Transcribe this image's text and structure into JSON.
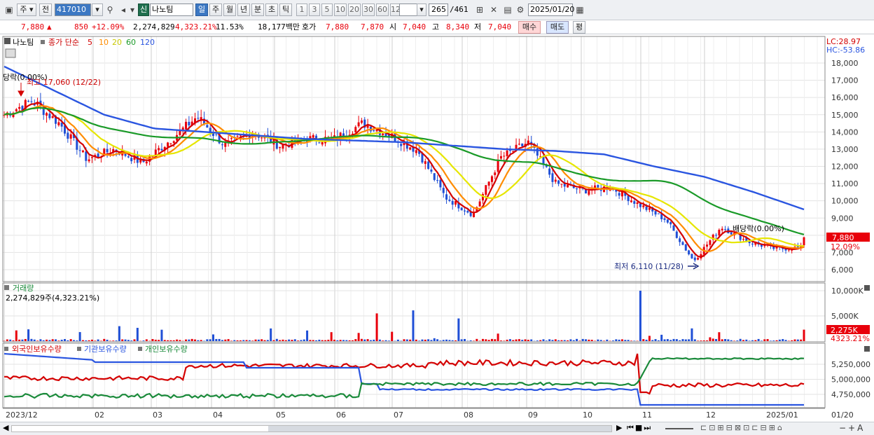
{
  "toolbar": {
    "type_label": "주",
    "prev_label": "전",
    "code_value": "417010",
    "market_badge": "신",
    "stock_name": "나노팀",
    "periods": [
      "일",
      "주",
      "월",
      "년",
      "분",
      "초",
      "틱"
    ],
    "active_period": "일",
    "intervals": [
      "1",
      "3",
      "5",
      "10",
      "20",
      "30",
      "60",
      "120"
    ],
    "count_value": "265",
    "count_total": "/461",
    "date_value": "2025/01/20"
  },
  "quote": {
    "price": "7,880",
    "change_arrow": "▲",
    "change": "850",
    "change_pct": "+12.09%",
    "volume": "2,274,829",
    "volume_ratio": "4,323.21%",
    "turnover": "11.53%",
    "amount": "18,177백만",
    "bid_label": "호가",
    "bid_sell": "7,880",
    "bid_buy": "7,870",
    "open_label": "시",
    "open": "7,040",
    "high_label": "고",
    "high": "8,340",
    "low_label": "저",
    "low": "7,040",
    "buy_label": "매수",
    "sell_label": "매도",
    "eval_label": "평"
  },
  "price_panel": {
    "title": "나노팀",
    "ma_label": "종가 단순",
    "ma_periods": [
      "5",
      "10",
      "20",
      "60",
      "120"
    ],
    "ma_colors": [
      "#d40000",
      "#ff8c00",
      "#e6e600",
      "#1a9a28",
      "#2a55e0"
    ],
    "lc": "LC:28.97",
    "hc": "HC:-53.86",
    "y_ticks": [
      "18,000",
      "17,000",
      "16,000",
      "15,000",
      "14,000",
      "13,000",
      "12,000",
      "11,000",
      "10,000",
      "9,000",
      "8,000",
      "7,000",
      "6,000"
    ],
    "last_price_tag": "7,880",
    "last_pct_tag": "12.09%",
    "annot_top_left": "당락(0.00%)",
    "annot_high": "최고 17,060 (12/22)",
    "annot_low": "최저 6,110 (11/28)",
    "annot_right": "배당락(0.00%)"
  },
  "volume_panel": {
    "title": "거래량",
    "value": "2,274,829주(4,323.21%)",
    "y_ticks": [
      "10,000K",
      "5,000K"
    ],
    "last_tag": "2,275K",
    "last_pct_tag": "4323.21%"
  },
  "holdings_panel": {
    "series": [
      "외국인보유수량",
      "기관보유수량",
      "개인보유수량"
    ],
    "series_colors": [
      "#d40000",
      "#2a55e0",
      "#1a8a3a"
    ],
    "y_ticks": [
      "5,250,000",
      "5,000,000",
      "4,750,000"
    ]
  },
  "x_axis": {
    "labels": [
      "2023/12",
      "02",
      "03",
      "04",
      "05",
      "06",
      "07",
      "08",
      "09",
      "10",
      "11",
      "12",
      "2025/01"
    ],
    "corner_label": "01/20"
  },
  "chart_data": {
    "type": "line",
    "title": "나노팀",
    "x_range": [
      "2023/12",
      "2025/01/20"
    ],
    "ylim": [
      6000,
      18500
    ],
    "series": [
      {
        "name": "5",
        "description": "close simple moving average",
        "values": [
          15000,
          15800,
          14500,
          12400,
          13000,
          12200,
          13500,
          14900,
          13200,
          14000,
          13200,
          13600,
          13600,
          14500,
          13800,
          12900,
          10200,
          9200,
          12500,
          13400,
          11000,
          10600,
          10800,
          9800,
          8900,
          6500,
          8500,
          7600,
          7200,
          7300
        ]
      },
      {
        "name": "120",
        "values": [
          17800,
          16400,
          15000,
          14200,
          14000,
          13800,
          13600,
          13500,
          13400,
          13200,
          13000,
          12900,
          12700,
          12000,
          11400,
          10500,
          9500
        ]
      }
    ],
    "annotations": {
      "high": "17,060 (12/22)",
      "low": "6,110 (11/28)"
    }
  }
}
